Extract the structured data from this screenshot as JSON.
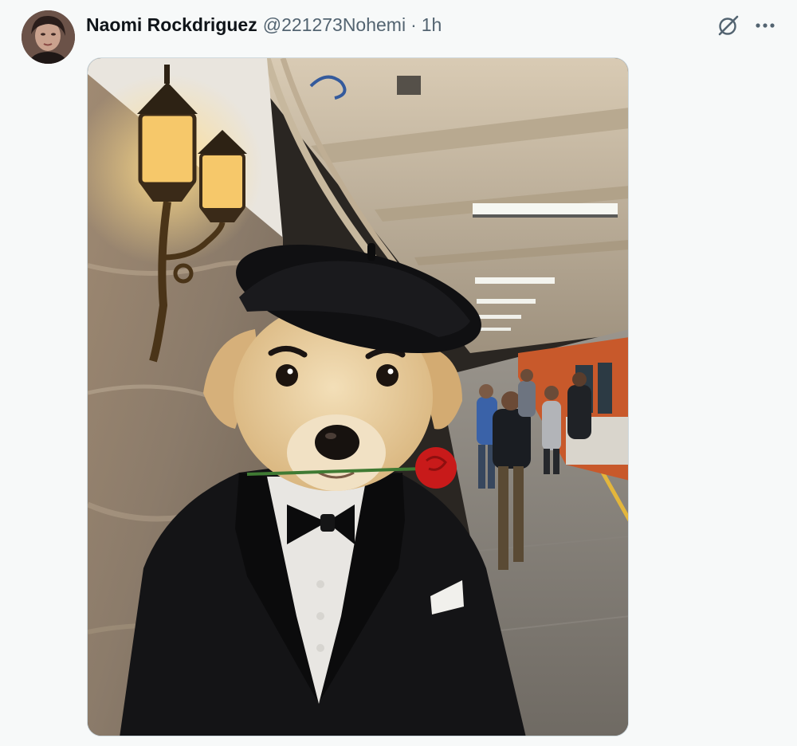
{
  "post": {
    "author_name": "Naomi Rockdriguez",
    "author_handle": "@221273Nohemi",
    "separator": "·",
    "timestamp": "1h"
  },
  "icons": {
    "grok": "grok-icon",
    "more": "more-dots-icon"
  },
  "colors": {
    "text_primary": "#0f1419",
    "text_secondary": "#536471",
    "background": "#f7f9f9",
    "media_border": "#cfd9de"
  }
}
